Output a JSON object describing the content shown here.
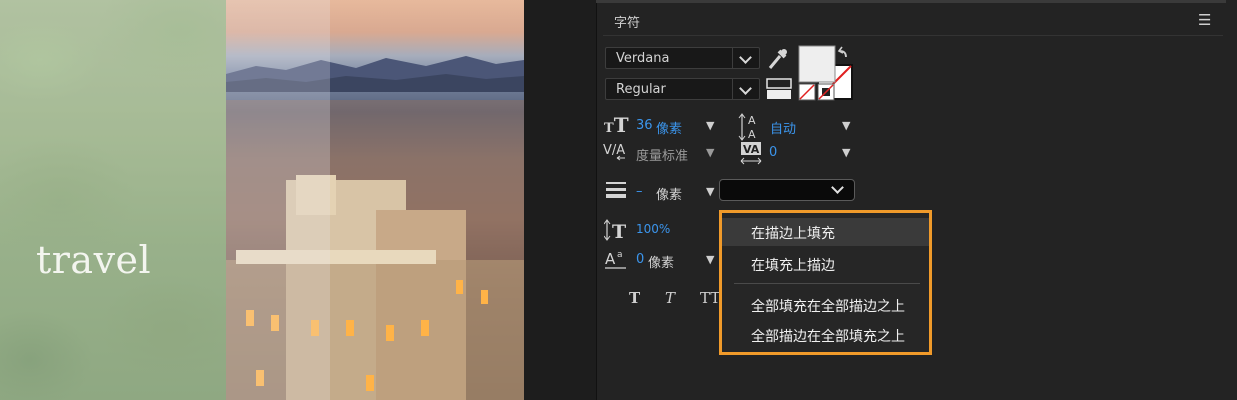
{
  "photo": {
    "overlay_text": "travel"
  },
  "panel": {
    "title": "字符",
    "menu_icon": "☰"
  },
  "font": {
    "family": "Verdana",
    "style": "Regular"
  },
  "colors": {
    "fill": "#eeeeee",
    "stroke": "none",
    "highlight": "#f09a2a",
    "accent_value": "#3b95ec"
  },
  "size": {
    "font_size_value": "36",
    "font_size_unit": "像素",
    "leading_value": "自动"
  },
  "kerning": {
    "label": "度量标准",
    "tracking_value": "0"
  },
  "stroke": {
    "width_value": "–",
    "width_unit": "像素"
  },
  "scale": {
    "vertical_value": "100%",
    "baseline_value": "0",
    "baseline_unit": "像素"
  },
  "style_buttons": [
    "T",
    "T",
    "TT"
  ],
  "stroke_menu": {
    "items": [
      "在描边上填充",
      "在填充上描边",
      "全部填充在全部描边之上",
      "全部描边在全部填充之上"
    ],
    "selected_index": 0
  }
}
